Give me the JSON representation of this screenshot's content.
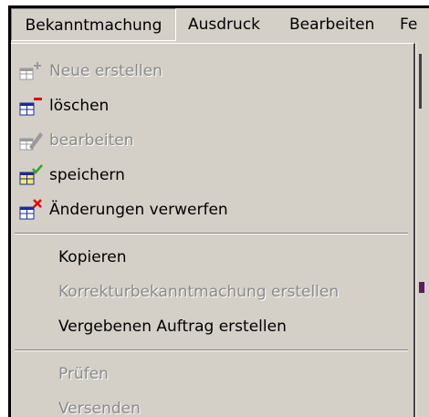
{
  "menubar": {
    "items": [
      "Bekanntmachung",
      "Ausdruck",
      "Bearbeiten",
      "Fe"
    ]
  },
  "menu": {
    "items": [
      {
        "label": "Neue erstellen",
        "enabled": false,
        "icon": "add-table-icon"
      },
      {
        "label": "löschen",
        "enabled": true,
        "icon": "delete-table-icon"
      },
      {
        "label": "bearbeiten",
        "enabled": false,
        "icon": "edit-table-icon"
      },
      {
        "label": "speichern",
        "enabled": true,
        "icon": "save-table-check-icon"
      },
      {
        "label": "Änderungen verwerfen",
        "enabled": true,
        "icon": "discard-changes-x-icon"
      },
      {
        "label": "Kopieren",
        "enabled": true
      },
      {
        "label": "Korrekturbekanntmachung erstellen",
        "enabled": false
      },
      {
        "label": "Vergebenen Auftrag erstellen",
        "enabled": true
      },
      {
        "label": "Prüfen",
        "enabled": false
      },
      {
        "label": "Versenden",
        "enabled": false
      }
    ]
  },
  "colors": {
    "menu_bg": "#d4d0c8",
    "disabled_text": "#8a8a8a",
    "remove_red": "#e00000",
    "check_green": "#3aa02a",
    "table_blue": "#1c2d8c"
  }
}
